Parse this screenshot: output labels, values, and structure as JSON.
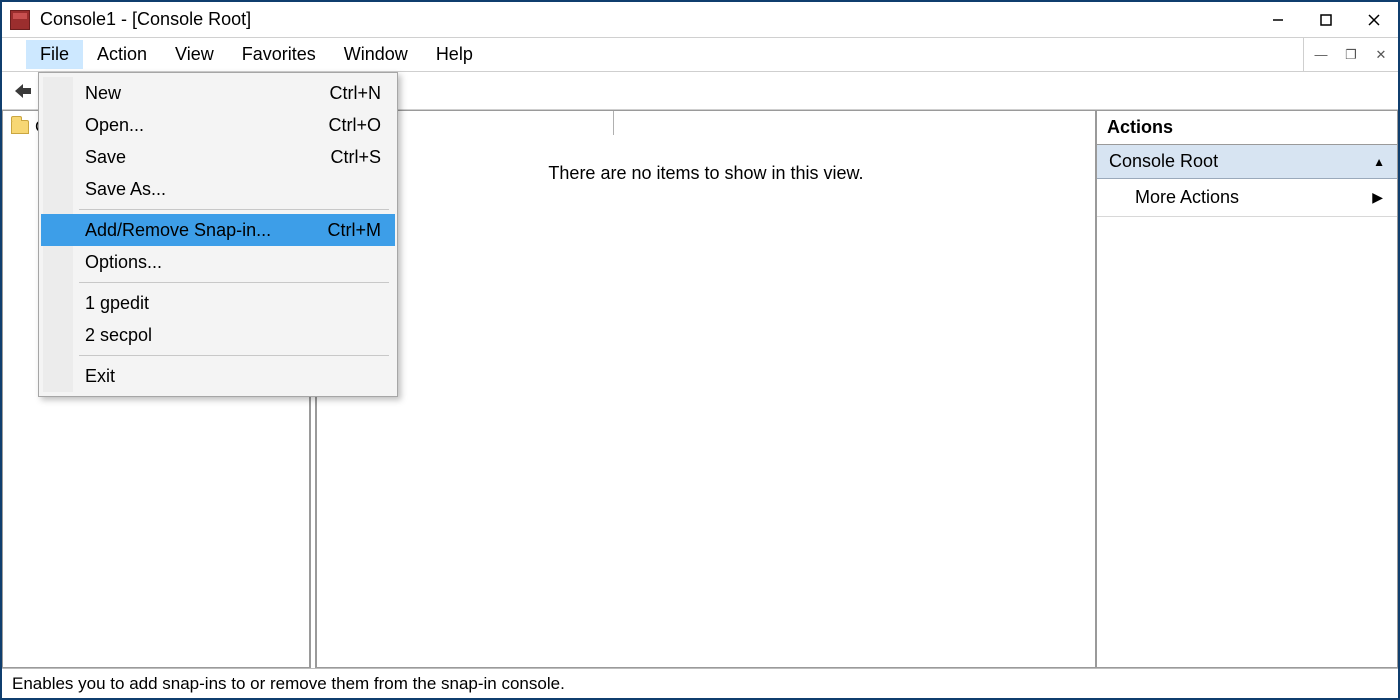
{
  "title": "Console1 - [Console Root]",
  "menubar": [
    "File",
    "Action",
    "View",
    "Favorites",
    "Window",
    "Help"
  ],
  "open_menu_index": 0,
  "file_menu": {
    "items": [
      {
        "label": "New",
        "shortcut": "Ctrl+N"
      },
      {
        "label": "Open...",
        "shortcut": "Ctrl+O"
      },
      {
        "label": "Save",
        "shortcut": "Ctrl+S"
      },
      {
        "label": "Save As...",
        "shortcut": ""
      },
      {
        "sep": true
      },
      {
        "label": "Add/Remove Snap-in...",
        "shortcut": "Ctrl+M",
        "highlight": true
      },
      {
        "label": "Options...",
        "shortcut": ""
      },
      {
        "sep": true
      },
      {
        "label": "1 gpedit",
        "shortcut": ""
      },
      {
        "label": "2 secpol",
        "shortcut": ""
      },
      {
        "sep": true
      },
      {
        "label": "Exit",
        "shortcut": ""
      }
    ]
  },
  "tree": {
    "root": "Console Root"
  },
  "content_empty_text": "There are no items to show in this view.",
  "actions": {
    "header": "Actions",
    "group": "Console Root",
    "links": [
      "More Actions"
    ]
  },
  "status": "Enables you to add snap-ins to or remove them from the snap-in console."
}
